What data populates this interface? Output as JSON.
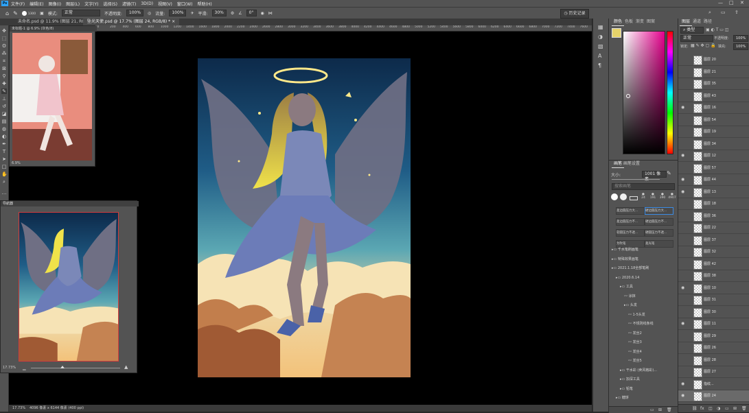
{
  "menubar": {
    "logo": "Ps",
    "items": [
      "文件(F)",
      "编辑(E)",
      "图像(I)",
      "图层(L)",
      "文字(Y)",
      "选择(S)",
      "滤镜(T)",
      "3D(D)",
      "视图(V)",
      "窗口(W)",
      "帮助(H)"
    ],
    "window_controls": {
      "minimize": "—",
      "maximize": "□",
      "close": "✕"
    }
  },
  "options": {
    "brush_size": "1300",
    "mode_label": "模式:",
    "mode_value": "正常",
    "opacity_label": "不透明度:",
    "opacity_value": "100%",
    "flow_label": "流量:",
    "flow_value": "100%",
    "smooth_label": "平滑:",
    "smooth_value": "30%",
    "angle_value": "0°",
    "history_button": "历史记录"
  },
  "tabs": [
    {
      "label": "未命名.psd @ 11.9% (图层 21, RGB/8) *"
    },
    {
      "label": "坠光天使.psd @ 17.7% (图层 24, RGB/8) *"
    }
  ],
  "ruler_ticks": [
    "-1400",
    "-1200",
    "-1000",
    "-800",
    "-600",
    "-400",
    "-200",
    "0",
    "200",
    "400",
    "600",
    "800",
    "1000",
    "1200",
    "1400",
    "1600",
    "1800",
    "2000",
    "2200",
    "2400",
    "2600",
    "2800",
    "3000",
    "3200",
    "3400",
    "3600",
    "3800",
    "4000",
    "4200",
    "4400",
    "4600",
    "4800",
    "5000",
    "5200",
    "5400",
    "5600",
    "5800",
    "6000",
    "6200",
    "6400",
    "6600",
    "6800",
    "7000",
    "7200",
    "7400",
    "7600"
  ],
  "reference_window": {
    "title": "未标题-1 @ 6.9% (灰色/8)",
    "zoom": "6.9%"
  },
  "navigator": {
    "title": "导航器",
    "zoom": "17.73%"
  },
  "status": {
    "zoom": "17.73%",
    "doc_info": "4096 像素 x 6144 像素 (400 ppi)"
  },
  "color_panel": {
    "tabs": [
      "颜色",
      "色板",
      "渐变",
      "图案"
    ],
    "swatch_fg": "#e6d36a"
  },
  "brush_panel": {
    "tabs": [
      "画笔",
      "画笔设置"
    ],
    "size_label": "大小:",
    "size_value": "1001 像素",
    "search_placeholder": "搜索画笔",
    "preset_sizes": [
      "24",
      "191",
      "390",
      "4907"
    ],
    "presets": [
      "柔边圆压力大...",
      "硬边圆压力大...",
      "柔边圆压力不...",
      "硬边圆压力不...",
      "软圆压力不透...",
      "硬圆压力不透...",
      "为吹笔",
      "柔光笔"
    ],
    "tree": [
      {
        "label": "千水笔刷画笔",
        "level": 0,
        "type": "folder"
      },
      {
        "label": "特殊效果画笔",
        "level": 0,
        "type": "folder"
      },
      {
        "label": "2021.1.18全部笔刷",
        "level": 0,
        "type": "folder"
      },
      {
        "label": "2020.6.14",
        "level": 1,
        "type": "folder"
      },
      {
        "label": "工具",
        "level": 2,
        "type": "folder"
      },
      {
        "label": "涂抹",
        "level": 3,
        "type": "brush"
      },
      {
        "label": "头发",
        "level": 3,
        "type": "folder"
      },
      {
        "label": "1-5头发",
        "level": 4,
        "type": "brush"
      },
      {
        "label": "不规则线条线",
        "level": 4,
        "type": "brush"
      },
      {
        "label": "发丝2",
        "level": 4,
        "type": "brush"
      },
      {
        "label": "发丝3",
        "level": 4,
        "type": "brush"
      },
      {
        "label": "发丝4",
        "level": 4,
        "type": "brush"
      },
      {
        "label": "发丝5",
        "level": 4,
        "type": "brush"
      },
      {
        "label": "干水彩 (卖风格彩)...",
        "level": 2,
        "type": "folder"
      },
      {
        "label": "加深工具",
        "level": 2,
        "type": "folder"
      },
      {
        "label": "铅笔",
        "level": 2,
        "type": "folder"
      },
      {
        "label": "糖饼",
        "level": 1,
        "type": "folder"
      }
    ]
  },
  "layers_panel": {
    "tabs": [
      "图层",
      "通道",
      "路径"
    ],
    "filter_label": "类型",
    "blend_mode": "正常",
    "opacity_label": "不透明度:",
    "opacity_value": "100%",
    "lock_label": "锁定:",
    "fill_label": "填充:",
    "fill_value": "100%",
    "layers": [
      {
        "name": "图层 20",
        "visible": false
      },
      {
        "name": "图层 21",
        "visible": false
      },
      {
        "name": "图层 35",
        "visible": false
      },
      {
        "name": "图层 43",
        "visible": false
      },
      {
        "name": "图层 16",
        "visible": true
      },
      {
        "name": "图层 54",
        "visible": false
      },
      {
        "name": "图层 19",
        "visible": false
      },
      {
        "name": "图层 34",
        "visible": false
      },
      {
        "name": "图层 12",
        "visible": true
      },
      {
        "name": "图层 57",
        "visible": false
      },
      {
        "name": "图层 44",
        "visible": true
      },
      {
        "name": "图层 13",
        "visible": true
      },
      {
        "name": "图层 18",
        "visible": false
      },
      {
        "name": "图层 36",
        "visible": false
      },
      {
        "name": "图层 22",
        "visible": false
      },
      {
        "name": "图层 37",
        "visible": false
      },
      {
        "name": "图层 32",
        "visible": false
      },
      {
        "name": "图层 42",
        "visible": false
      },
      {
        "name": "图层 38",
        "visible": false
      },
      {
        "name": "图层 10",
        "visible": true
      },
      {
        "name": "图层 31",
        "visible": false
      },
      {
        "name": "图层 30",
        "visible": false
      },
      {
        "name": "图层 11",
        "visible": true
      },
      {
        "name": "图层 29",
        "visible": false
      },
      {
        "name": "图层 26",
        "visible": false
      },
      {
        "name": "图层 28",
        "visible": false
      },
      {
        "name": "图层 27",
        "visible": false
      },
      {
        "name": "指纹...",
        "visible": true
      },
      {
        "name": "图层 24",
        "visible": true
      }
    ]
  }
}
